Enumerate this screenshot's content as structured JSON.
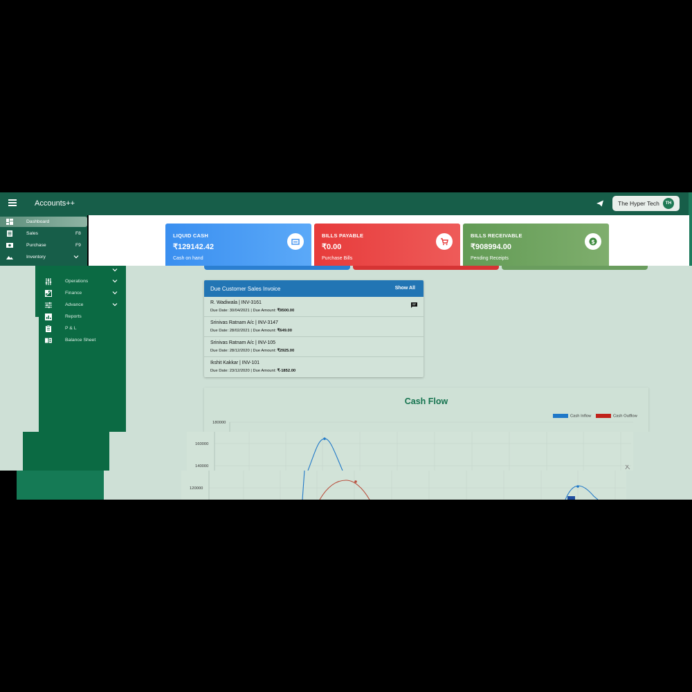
{
  "app": {
    "title": "Accounts++"
  },
  "user": {
    "name": "The Hyper Tech",
    "initials": "TH"
  },
  "sidebar": {
    "items": [
      {
        "label": "Dashboard",
        "icon": "dashboard-icon"
      },
      {
        "label": "Sales",
        "shortcut": "F8",
        "icon": "receipt-icon"
      },
      {
        "label": "Purchase",
        "shortcut": "F9",
        "icon": "money-icon"
      },
      {
        "label": "Inventory",
        "icon": "landscape-icon"
      },
      {
        "label": "Operations",
        "icon": "sliders-icon"
      },
      {
        "label": "Finance",
        "icon": "finance-icon"
      },
      {
        "label": "Advance",
        "icon": "tune-icon"
      },
      {
        "label": "Reports",
        "icon": "chart-icon"
      },
      {
        "label": "P & L",
        "icon": "clipboard-icon"
      },
      {
        "label": "Balance Sheet",
        "icon": "book-icon"
      }
    ]
  },
  "cards": [
    {
      "title": "LIQUID CASH",
      "value": "₹129142.42",
      "subtitle": "Cash on hand",
      "icon": "wallet-icon",
      "color": "#3a8ff0"
    },
    {
      "title": "BILLS PAYABLE",
      "value": "₹0.00",
      "subtitle": "Purchase Bills",
      "icon": "cart-icon",
      "color": "#e73b3b"
    },
    {
      "title": "BILLS RECEIVABLE",
      "value": "₹908994.00",
      "subtitle": "Pending Receipts",
      "icon": "dollar-icon",
      "color": "#629b55"
    }
  ],
  "invoices": {
    "title": "Due Customer Sales Invoice",
    "show_all": "Show All",
    "rows": [
      {
        "name": "R. Wadiwala | INV-3161",
        "due_prefix": "Due Date: 30/04/2021 | Due Amount: ",
        "amount": "₹9500.00"
      },
      {
        "name": "Srinivas Ratnam A/c | INV-3147",
        "due_prefix": "Due Date: 28/02/2021 | Due Amount: ",
        "amount": "₹649.00"
      },
      {
        "name": "Srinivas Ratnam A/c | INV-105",
        "due_prefix": "Due Date: 28/12/2020 | Due Amount: ",
        "amount": "₹2925.00"
      },
      {
        "name": "Ikshit Kakkar | INV-101",
        "due_prefix": "Due Date: 23/12/2020 | Due Amount: ",
        "amount": "₹-1852.00"
      }
    ]
  },
  "cashflow": {
    "title": "Cash Flow",
    "legend": [
      {
        "name": "Cash Inflow",
        "color": "#1f78c8"
      },
      {
        "name": "Cash Outflow",
        "color": "#c0221a"
      }
    ],
    "y_ticks": [
      "180000",
      "160000",
      "140000",
      "120000"
    ]
  }
}
